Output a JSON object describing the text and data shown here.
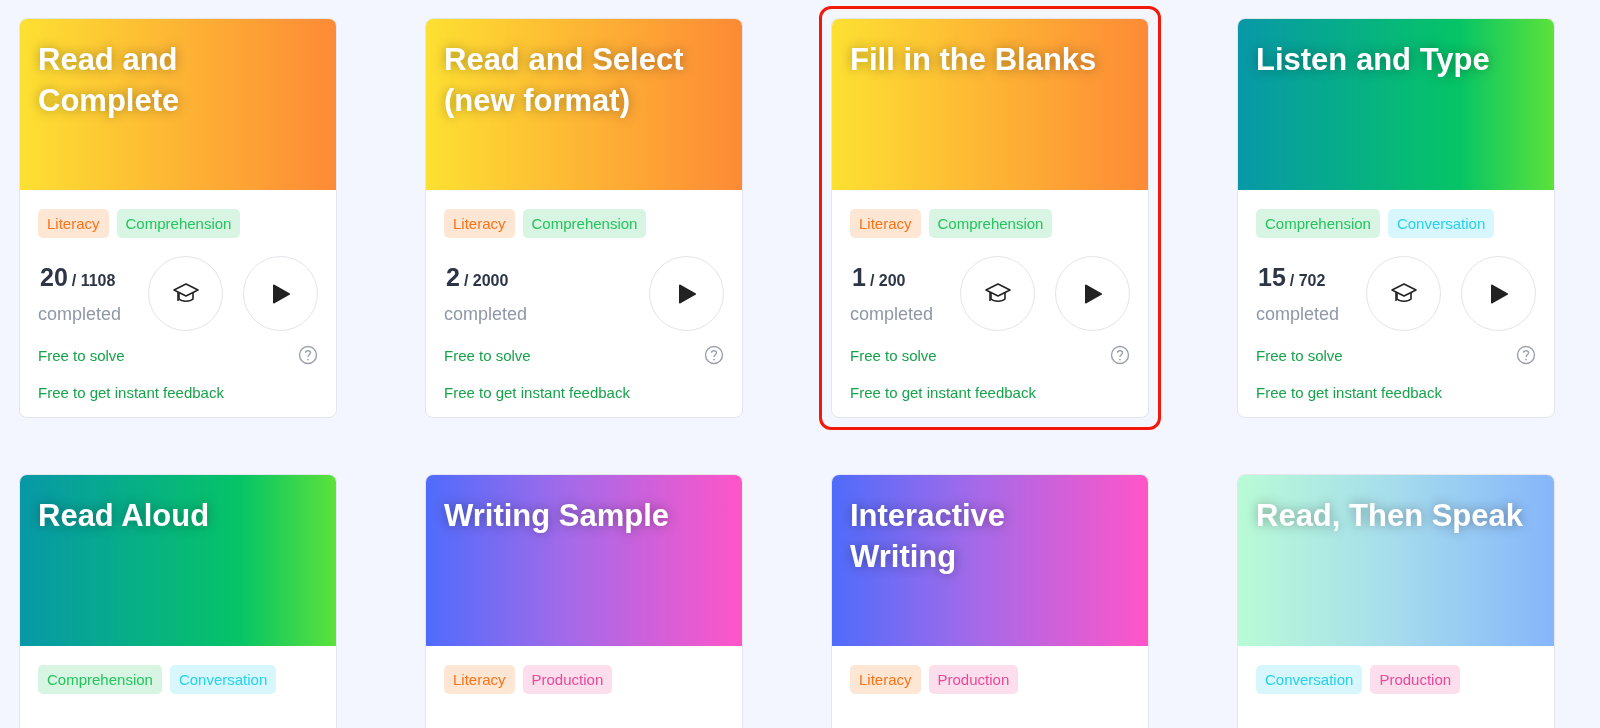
{
  "cards": [
    {
      "title": "Read and Complete",
      "kind": "orange",
      "highlighted": false,
      "tags": [
        {
          "label": "Literacy",
          "color": "#f97316"
        },
        {
          "label": "Comprehension",
          "color": "#22c55e"
        }
      ],
      "done": "20",
      "total": "/ 1108",
      "status": "completed",
      "buttons": [
        {
          "kind": "learn"
        },
        {
          "kind": "play"
        }
      ],
      "notes": [
        "Free to solve",
        "Free to get instant feedback"
      ]
    },
    {
      "title": "Read and Select (new format)",
      "kind": "orange",
      "highlighted": false,
      "tags": [
        {
          "label": "Literacy",
          "color": "#f97316"
        },
        {
          "label": "Comprehension",
          "color": "#22c55e"
        }
      ],
      "done": "2",
      "total": "/ 2000",
      "status": "completed",
      "buttons": [
        {
          "kind": "play"
        }
      ],
      "notes": [
        "Free to solve",
        "Free to get instant feedback"
      ]
    },
    {
      "title": "Fill in the Blanks",
      "kind": "orange",
      "highlighted": true,
      "tags": [
        {
          "label": "Literacy",
          "color": "#f97316"
        },
        {
          "label": "Comprehension",
          "color": "#22c55e"
        }
      ],
      "done": "1",
      "total": "/ 200",
      "status": "completed",
      "buttons": [
        {
          "kind": "learn"
        },
        {
          "kind": "play"
        }
      ],
      "notes": [
        "Free to solve",
        "Free to get instant feedback"
      ]
    },
    {
      "title": "Listen and Type",
      "kind": "green",
      "highlighted": false,
      "tags": [
        {
          "label": "Comprehension",
          "color": "#22c55e"
        },
        {
          "label": "Conversation",
          "color": "#22d3ee"
        }
      ],
      "done": "15",
      "total": "/ 702",
      "status": "completed",
      "buttons": [
        {
          "kind": "learn"
        },
        {
          "kind": "play"
        }
      ],
      "notes": [
        "Free to solve",
        "Free to get instant feedback"
      ]
    },
    {
      "title": "Read Aloud",
      "kind": "green",
      "highlighted": false,
      "tags": [
        {
          "label": "Comprehension",
          "color": "#22c55e"
        },
        {
          "label": "Conversation",
          "color": "#22d3ee"
        }
      ]
    },
    {
      "title": "Writing Sample",
      "kind": "purple",
      "highlighted": false,
      "tags": [
        {
          "label": "Literacy",
          "color": "#f97316"
        },
        {
          "label": "Production",
          "color": "#ec4899"
        }
      ]
    },
    {
      "title": "Interactive Writing",
      "kind": "purple",
      "highlighted": false,
      "tags": [
        {
          "label": "Literacy",
          "color": "#f97316"
        },
        {
          "label": "Production",
          "color": "#ec4899"
        }
      ]
    },
    {
      "title": "Read, Then Speak",
      "kind": "mint",
      "highlighted": false,
      "tags": [
        {
          "label": "Conversation",
          "color": "#22d3ee"
        },
        {
          "label": "Production",
          "color": "#ec4899"
        }
      ]
    }
  ]
}
